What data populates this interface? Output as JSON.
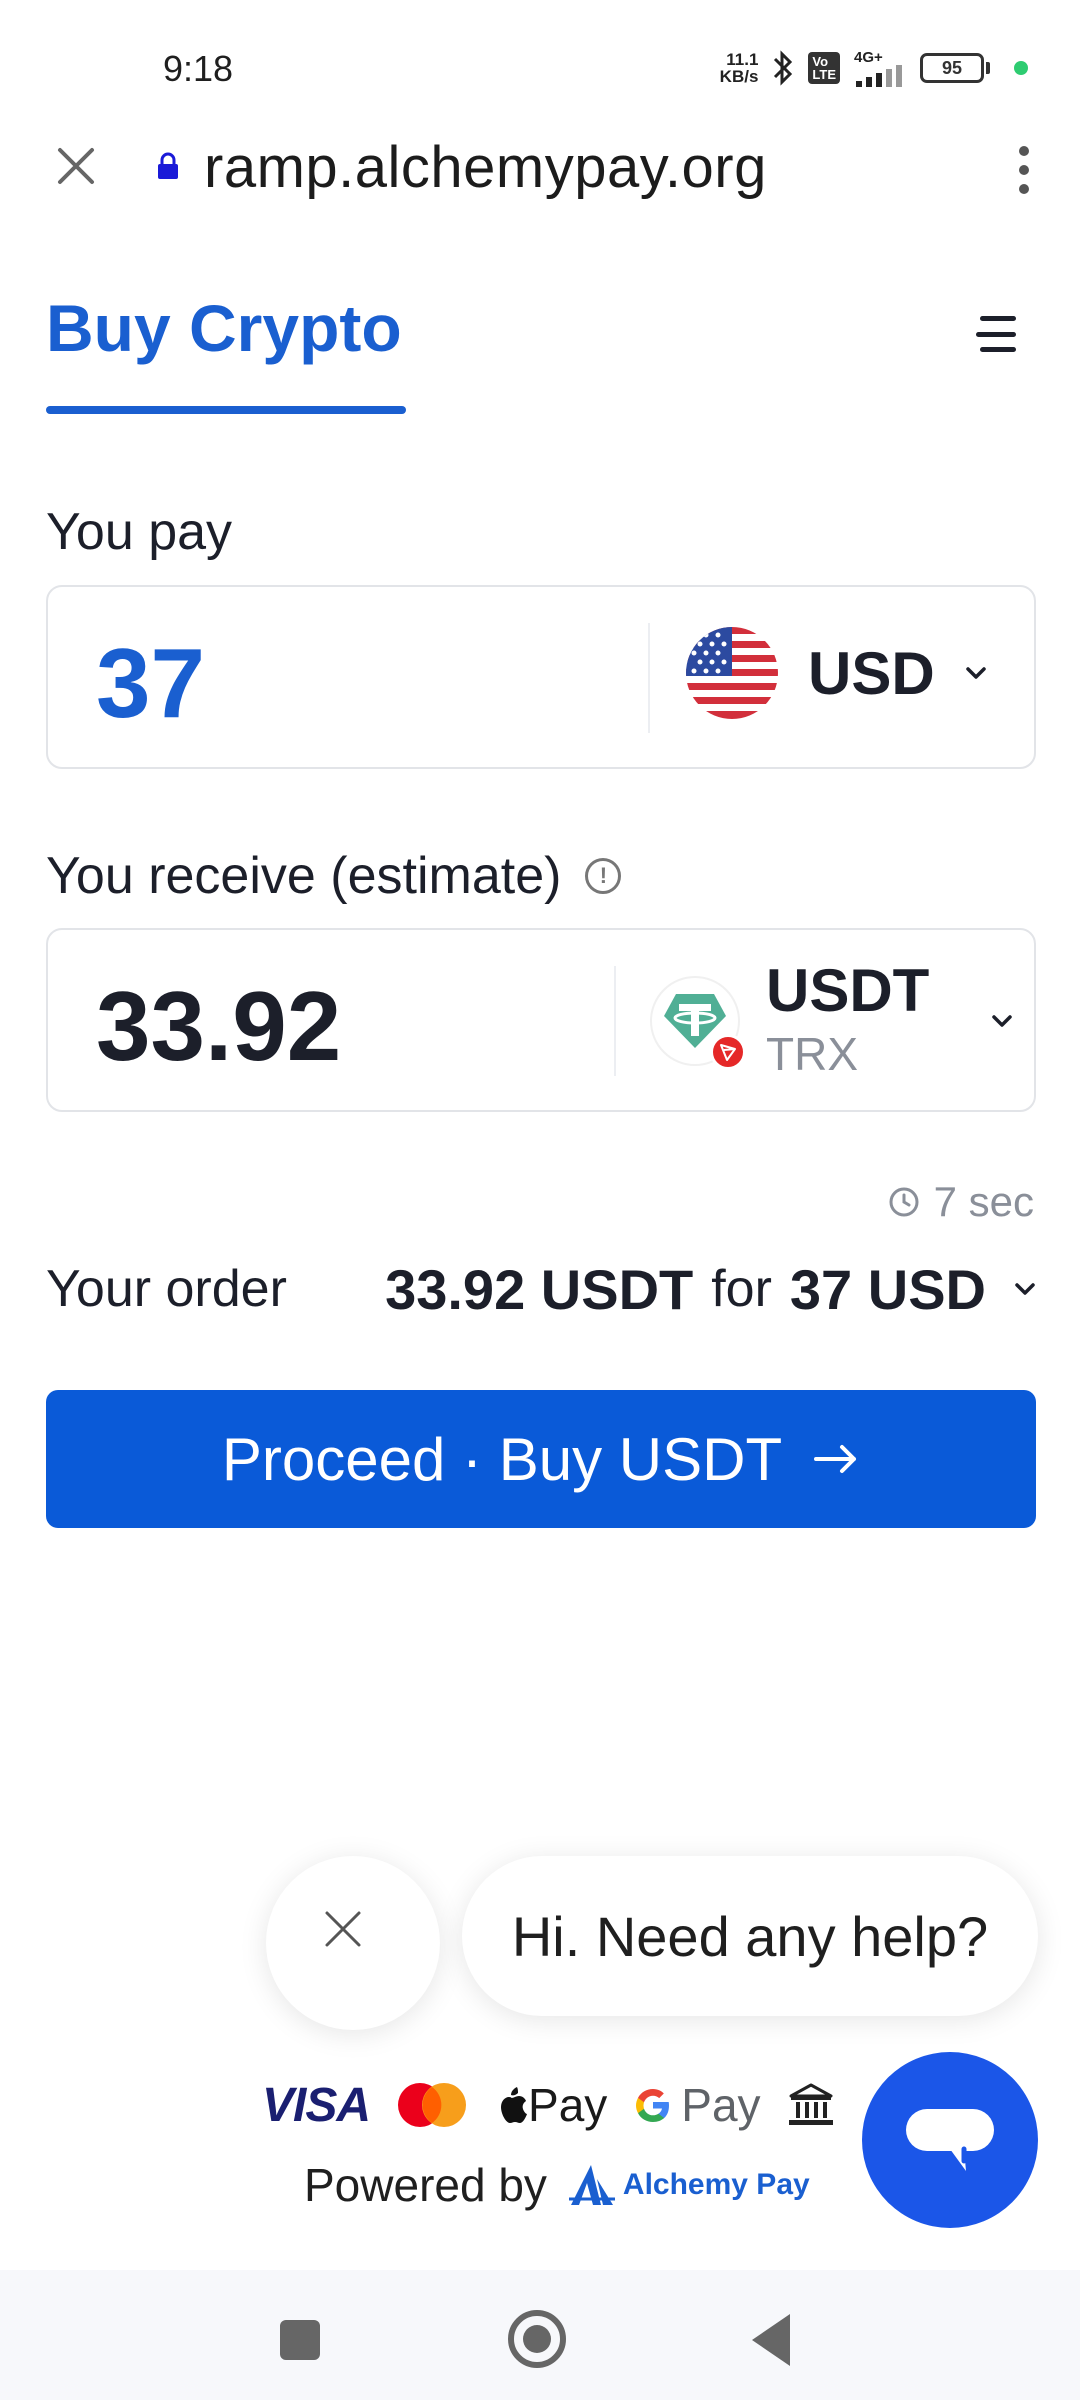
{
  "status_bar": {
    "time": "9:18",
    "net_speed_value": "11.1",
    "net_speed_unit": "KB/s",
    "volte_top": "Vo",
    "volte_bottom": "LTE",
    "network": "4G+",
    "battery": "95"
  },
  "browser": {
    "url": "ramp.alchemypay.org"
  },
  "header": {
    "tab_label": "Buy Crypto"
  },
  "pay": {
    "label": "You pay",
    "amount": "37",
    "currency": "USD"
  },
  "receive": {
    "label": "You receive (estimate)",
    "amount": "33.92",
    "token": "USDT",
    "network": "TRX"
  },
  "timer": {
    "text": "7 sec"
  },
  "order": {
    "label": "Your order",
    "receive_amount": "33.92 USDT",
    "for_word": "for",
    "pay_amount": "37 USD"
  },
  "proceed_button": {
    "label": "Proceed · Buy USDT"
  },
  "help": {
    "message": "Hi. Need any help?"
  },
  "payments": {
    "visa": "VISA",
    "apple_pay": "Pay",
    "google_pay": "Pay"
  },
  "footer": {
    "powered_by": "Powered by",
    "brand_name": "Alchemy Pay"
  },
  "colors": {
    "accent": "#1a5fd0",
    "proceed": "#0a5ad8",
    "chat_fab": "#1b56e8",
    "tether": "#50af95",
    "trx": "#e52828"
  }
}
